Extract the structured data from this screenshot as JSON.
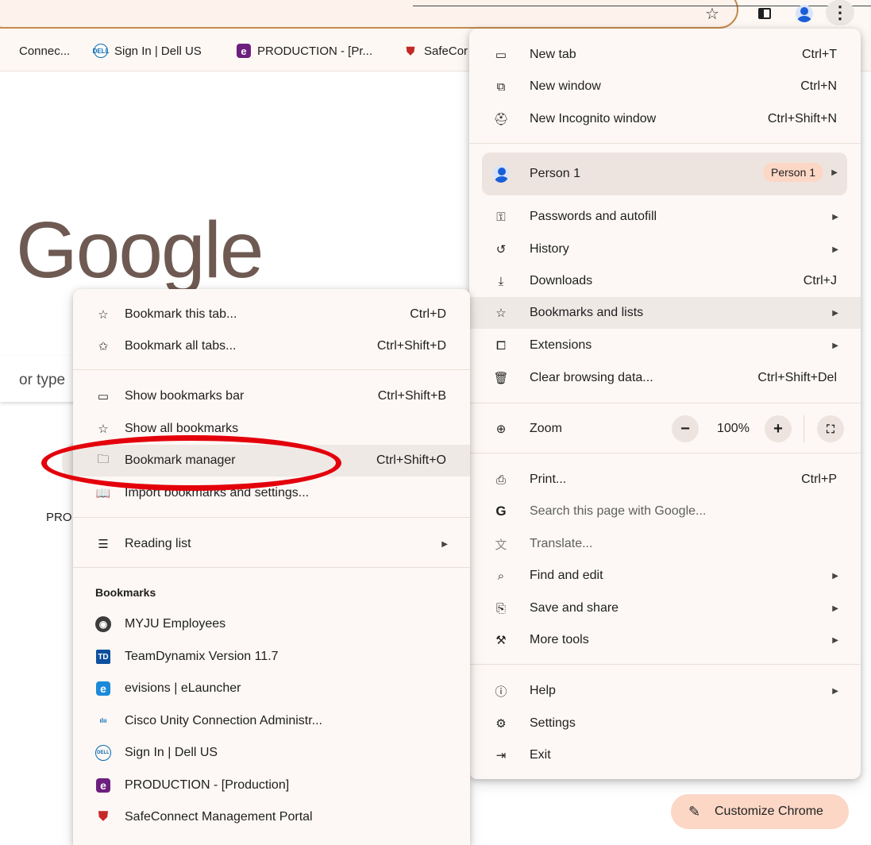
{
  "bookmarks_bar": {
    "items": [
      {
        "label": "Connec...",
        "favicon": "cisco-favicon"
      },
      {
        "label": "Sign In | Dell US",
        "favicon": "dell-favicon"
      },
      {
        "label": "PRODUCTION - [Pr...",
        "favicon": "evisions-favicon"
      },
      {
        "label": "SafeCor",
        "favicon": "safeconnect-favicon"
      }
    ]
  },
  "page": {
    "logo_text": "Google",
    "search_placeholder_fragment": "or type",
    "shortcut_fragment": "PRO"
  },
  "main_menu": {
    "new_tab": {
      "label": "New tab",
      "shortcut": "Ctrl+T"
    },
    "new_window": {
      "label": "New window",
      "shortcut": "Ctrl+N"
    },
    "new_incognito": {
      "label": "New Incognito window",
      "shortcut": "Ctrl+Shift+N"
    },
    "profile": {
      "label": "Person 1",
      "badge": "Person 1"
    },
    "passwords": {
      "label": "Passwords and autofill"
    },
    "history": {
      "label": "History"
    },
    "downloads": {
      "label": "Downloads",
      "shortcut": "Ctrl+J"
    },
    "bookmarks": {
      "label": "Bookmarks and lists"
    },
    "extensions": {
      "label": "Extensions"
    },
    "clear_data": {
      "label": "Clear browsing data...",
      "shortcut": "Ctrl+Shift+Del"
    },
    "zoom": {
      "label": "Zoom",
      "value": "100%",
      "minus": "−",
      "plus": "+"
    },
    "print": {
      "label": "Print...",
      "shortcut": "Ctrl+P"
    },
    "search_page": {
      "label": "Search this page with Google..."
    },
    "translate": {
      "label": "Translate..."
    },
    "find_edit": {
      "label": "Find and edit"
    },
    "save_share": {
      "label": "Save and share"
    },
    "more_tools": {
      "label": "More tools"
    },
    "help": {
      "label": "Help"
    },
    "settings": {
      "label": "Settings"
    },
    "exit": {
      "label": "Exit"
    }
  },
  "bookmarks_menu": {
    "bookmark_tab": {
      "label": "Bookmark this tab...",
      "shortcut": "Ctrl+D"
    },
    "bookmark_all": {
      "label": "Bookmark all tabs...",
      "shortcut": "Ctrl+Shift+D"
    },
    "show_bar": {
      "label": "Show bookmarks bar",
      "shortcut": "Ctrl+Shift+B"
    },
    "show_all": {
      "label": "Show all bookmarks"
    },
    "manager": {
      "label": "Bookmark manager",
      "shortcut": "Ctrl+Shift+O"
    },
    "import": {
      "label": "Import bookmarks and settings..."
    },
    "reading_list": {
      "label": "Reading list"
    },
    "section_title": "Bookmarks",
    "items": [
      {
        "label": "MYJU Employees",
        "favicon": "globe-favicon"
      },
      {
        "label": "TeamDynamix Version 11.7",
        "favicon": "teamdynamix-favicon",
        "glyph": "TD"
      },
      {
        "label": "evisions | eLauncher",
        "favicon": "evisions-favicon",
        "glyph": "e"
      },
      {
        "label": "Cisco Unity Connection Administr...",
        "favicon": "cisco-favicon"
      },
      {
        "label": "Sign In | Dell US",
        "favicon": "dell-favicon"
      },
      {
        "label": "PRODUCTION - [Production]",
        "favicon": "evisions-production-favicon",
        "glyph": "e"
      },
      {
        "label": "SafeConnect Management Portal",
        "favicon": "safeconnect-favicon"
      }
    ]
  },
  "customize": {
    "label": "Customize Chrome"
  },
  "colors": {
    "menu_bg": "#fdf8f5",
    "highlight": "#efe9e6",
    "accent_badge": "#fcd7c6",
    "annotation_red": "#e3000b",
    "profile_blue": "#1a5fd6"
  }
}
